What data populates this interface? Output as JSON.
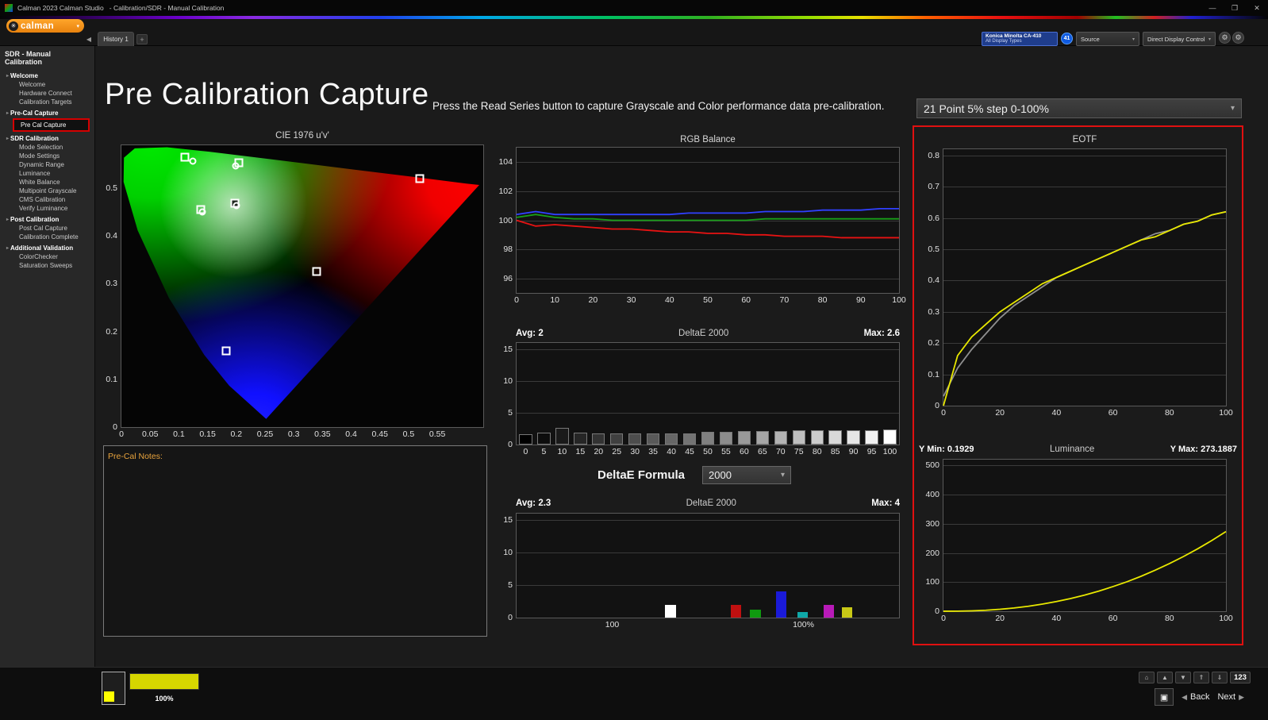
{
  "ui": {
    "caret": "▾",
    "collapse_arrow": "◀",
    "section_arrow": "▸",
    "settings_icon": "⚙",
    "logo_icon": "✳"
  },
  "window": {
    "title": "Calman 2023 Calman Studio   - Calibration/SDR - Manual Calibration",
    "minimize": "—",
    "maximize": "❐",
    "close": "✕"
  },
  "brand": {
    "logo": "calman"
  },
  "toolbar": {
    "history_tab": "History 1",
    "add_tab": "+",
    "meter_line1": "Konica Minolta CA-410",
    "meter_line2": "All Display Types",
    "meter_badge": "41",
    "source_label": "Source",
    "display_control_label": "Direct Display Control"
  },
  "sidebar": {
    "title": "SDR - Manual Calibration",
    "sections": [
      {
        "label": "Welcome",
        "items": [
          "Welcome",
          "Hardware Connect",
          "Calibration Targets"
        ]
      },
      {
        "label": "Pre-Cal Capture",
        "items": [
          "Pre Cal Capture"
        ],
        "selected": "Pre Cal Capture"
      },
      {
        "label": "SDR Calibration",
        "items": [
          "Mode Selection",
          "Mode Settings",
          "Dynamic Range",
          "Luminance",
          "White Balance",
          "Multipoint Grayscale",
          "CMS Calibration",
          "Verify Luminance"
        ]
      },
      {
        "label": "Post Calibration",
        "items": [
          "Post Cal Capture",
          "Calibration Complete"
        ]
      },
      {
        "label": "Additional Validation",
        "items": [
          "ColorChecker",
          "Saturation Sweeps"
        ]
      }
    ]
  },
  "main": {
    "heading": "Pre Calibration Capture",
    "instruction": "Press the Read Series button to capture Grayscale and Color performance data pre-calibration.",
    "series_selection": "21 Point 5% step 0-100%",
    "notes_label": "Pre-Cal Notes:",
    "formula_label": "DeltaE Formula",
    "formula_value": "2000"
  },
  "bottom": {
    "pattern_level": "100%",
    "patterns_button": "123",
    "pattern_window": "▣",
    "back": "Back",
    "next": "Next",
    "back_arrow": "◀",
    "next_arrow": "▶",
    "nav_icons": [
      {
        "glyph": "⌂",
        "name": "home"
      },
      {
        "glyph": "▲",
        "name": "up"
      },
      {
        "glyph": "▼",
        "name": "down"
      },
      {
        "glyph": "⇑",
        "name": "page-up"
      },
      {
        "glyph": "⇓",
        "name": "page-down"
      }
    ]
  },
  "chart_data": [
    {
      "id": "cie",
      "type": "scatter",
      "title": "CIE 1976 u'v'",
      "xlim": [
        0,
        0.63
      ],
      "ylim": [
        0,
        0.59
      ],
      "xticks": [
        0,
        0.05,
        0.1,
        0.15,
        0.2,
        0.25,
        0.3,
        0.35,
        0.4,
        0.45,
        0.5,
        0.55
      ],
      "yticks": [
        0,
        0.1,
        0.2,
        0.3,
        0.4,
        0.5
      ],
      "points": [
        {
          "u": 0.11,
          "v": 0.565,
          "kind": "target"
        },
        {
          "u": 0.125,
          "v": 0.556,
          "kind": "measured"
        },
        {
          "u": 0.204,
          "v": 0.553,
          "kind": "target"
        },
        {
          "u": 0.199,
          "v": 0.546,
          "kind": "measured"
        },
        {
          "u": 0.138,
          "v": 0.455,
          "kind": "target"
        },
        {
          "u": 0.141,
          "v": 0.451,
          "kind": "measured"
        },
        {
          "u": 0.198,
          "v": 0.468,
          "kind": "white"
        },
        {
          "u": 0.2,
          "v": 0.464,
          "kind": "measured"
        },
        {
          "u": 0.34,
          "v": 0.326,
          "kind": "target"
        },
        {
          "u": 0.52,
          "v": 0.52,
          "kind": "target"
        },
        {
          "u": 0.183,
          "v": 0.16,
          "kind": "target"
        }
      ]
    },
    {
      "id": "rgb_balance",
      "type": "line",
      "title": "RGB Balance",
      "xlim": [
        0,
        100
      ],
      "ylim": [
        95,
        105
      ],
      "xticks": [
        0,
        10,
        20,
        30,
        40,
        50,
        60,
        70,
        80,
        90,
        100
      ],
      "yticks": [
        96,
        98,
        100,
        102,
        104
      ],
      "x": [
        0,
        5,
        10,
        15,
        20,
        25,
        30,
        35,
        40,
        45,
        50,
        55,
        60,
        65,
        70,
        75,
        80,
        85,
        90,
        95,
        100
      ],
      "series": [
        {
          "name": "Red",
          "color": "#e81212",
          "values": [
            100.0,
            99.6,
            99.7,
            99.6,
            99.5,
            99.4,
            99.4,
            99.3,
            99.2,
            99.2,
            99.1,
            99.1,
            99.0,
            99.0,
            98.9,
            98.9,
            98.9,
            98.8,
            98.8,
            98.8,
            98.8
          ]
        },
        {
          "name": "Green",
          "color": "#18a018",
          "values": [
            100.2,
            100.4,
            100.2,
            100.1,
            100.1,
            100.0,
            100.0,
            100.0,
            100.0,
            100.0,
            100.0,
            100.0,
            100.0,
            100.1,
            100.1,
            100.1,
            100.1,
            100.1,
            100.1,
            100.1,
            100.1
          ]
        },
        {
          "name": "Blue",
          "color": "#3040ff",
          "values": [
            100.4,
            100.6,
            100.4,
            100.4,
            100.4,
            100.4,
            100.4,
            100.4,
            100.4,
            100.5,
            100.5,
            100.5,
            100.5,
            100.6,
            100.6,
            100.6,
            100.7,
            100.7,
            100.7,
            100.8,
            100.8
          ]
        }
      ]
    },
    {
      "id": "deltae_grayscale",
      "type": "bar",
      "title": "DeltaE 2000",
      "avg_label": "Avg: 2",
      "max_label": "Max: 2.6",
      "avg": 2,
      "max": 2.6,
      "ylim": [
        0,
        16
      ],
      "yticks": [
        0,
        5,
        10,
        15
      ],
      "categories": [
        0,
        5,
        10,
        15,
        20,
        25,
        30,
        35,
        40,
        45,
        50,
        55,
        60,
        65,
        70,
        75,
        80,
        85,
        90,
        95,
        100
      ],
      "values": [
        1.6,
        1.9,
        2.6,
        1.9,
        1.8,
        1.8,
        1.7,
        1.8,
        1.8,
        1.8,
        2.0,
        2.0,
        2.1,
        2.1,
        2.1,
        2.2,
        2.2,
        2.3,
        2.3,
        2.3,
        2.4
      ]
    },
    {
      "id": "deltae_color",
      "type": "bar",
      "title": "DeltaE 2000",
      "avg_label": "Avg: 2.3",
      "max_label": "Max: 4",
      "avg": 2.3,
      "max": 4,
      "ylim": [
        0,
        16
      ],
      "yticks": [
        0,
        5,
        10,
        15
      ],
      "bars": [
        {
          "name": "White",
          "x": 0.403,
          "color": "#ffffff",
          "value": 2.0
        },
        {
          "name": "Red",
          "x": 0.574,
          "color": "#c01010",
          "value": 1.9
        },
        {
          "name": "Green",
          "x": 0.624,
          "color": "#0f9a0f",
          "value": 1.2
        },
        {
          "name": "Blue",
          "x": 0.692,
          "color": "#1a1ad8",
          "value": 4.0
        },
        {
          "name": "Cyan",
          "x": 0.748,
          "color": "#0fa8a8",
          "value": 0.8
        },
        {
          "name": "Magenta",
          "x": 0.816,
          "color": "#b81ab8",
          "value": 1.9
        },
        {
          "name": "Yellow",
          "x": 0.864,
          "color": "#c8c816",
          "value": 1.6
        }
      ],
      "xlabels": [
        {
          "x": 0.25,
          "label": "100"
        },
        {
          "x": 0.75,
          "label": "100%"
        }
      ]
    },
    {
      "id": "eotf",
      "type": "line",
      "title": "EOTF",
      "xlim": [
        0,
        100
      ],
      "ylim": [
        0,
        0.82
      ],
      "xticks": [
        0,
        20,
        40,
        60,
        80,
        100
      ],
      "yticks": [
        0,
        0.1,
        0.2,
        0.3,
        0.4,
        0.5,
        0.6,
        0.7,
        0.8
      ],
      "x": [
        0,
        5,
        10,
        15,
        20,
        25,
        30,
        35,
        40,
        45,
        50,
        55,
        60,
        65,
        70,
        75,
        80,
        85,
        90,
        95,
        100
      ],
      "series": [
        {
          "name": "Reference",
          "color": "#8f8f8f",
          "values": [
            0.03,
            0.12,
            0.18,
            0.23,
            0.28,
            0.32,
            0.35,
            0.38,
            0.41,
            0.43,
            0.45,
            0.47,
            0.49,
            0.51,
            0.53,
            0.55,
            0.56,
            0.58,
            0.59,
            0.61,
            0.62
          ]
        },
        {
          "name": "Measured",
          "color": "#e8e800",
          "values": [
            0.0,
            0.16,
            0.22,
            0.26,
            0.3,
            0.33,
            0.36,
            0.39,
            0.41,
            0.43,
            0.45,
            0.47,
            0.49,
            0.51,
            0.53,
            0.54,
            0.56,
            0.58,
            0.59,
            0.61,
            0.62
          ]
        }
      ]
    },
    {
      "id": "luminance",
      "type": "line",
      "title": "Luminance",
      "ymin_label": "Y Min: 0.1929",
      "ymax_label": "Y Max: 273.1887",
      "y_min": 0.1929,
      "y_max": 273.1887,
      "xlim": [
        0,
        100
      ],
      "ylim": [
        0,
        520
      ],
      "xticks": [
        0,
        20,
        40,
        60,
        80,
        100
      ],
      "yticks": [
        0,
        100,
        200,
        300,
        400,
        500
      ],
      "x": [
        0,
        5,
        10,
        15,
        20,
        25,
        30,
        35,
        40,
        45,
        50,
        55,
        60,
        65,
        70,
        75,
        80,
        85,
        90,
        95,
        100
      ],
      "series": [
        {
          "name": "Measured",
          "color": "#e8e800",
          "values": [
            0.2,
            0.3,
            1.4,
            3.5,
            6.7,
            11.2,
            17.1,
            24.5,
            33.3,
            43.5,
            55.4,
            69.1,
            84.6,
            101.2,
            120.1,
            140.9,
            163.5,
            187.9,
            214.3,
            242.6,
            273.2
          ]
        }
      ]
    }
  ]
}
